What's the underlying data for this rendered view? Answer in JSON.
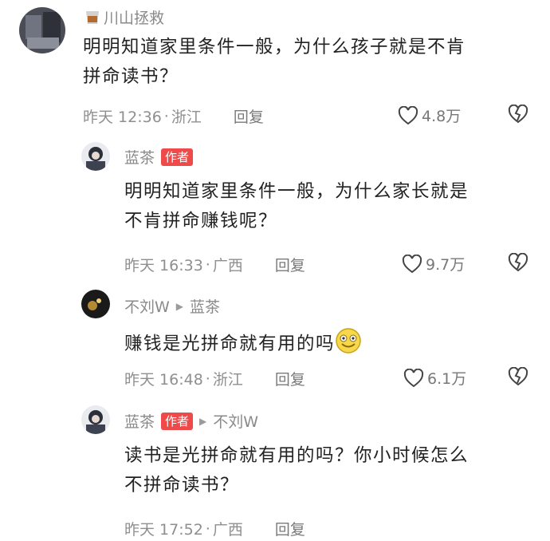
{
  "comments": [
    {
      "username": "川山拯救",
      "text_line1": "明明知道家里条件一般，为什么孩子就是不肯",
      "text_line2": "拼命读书？",
      "time": "昨天 12:36",
      "location": "浙江",
      "reply_label": "回复",
      "likes": "4.8万"
    },
    {
      "username": "蓝茶",
      "badge": "作者",
      "text_line1": "明明知道家里条件一般，为什么家长就是",
      "text_line2": "不肯拼命赚钱呢？",
      "time": "昨天 16:33",
      "location": "广西",
      "reply_label": "回复",
      "likes": "9.7万"
    },
    {
      "username": "不刘W",
      "reply_to": "蓝茶",
      "text_line1": "赚钱是光拼命就有用的吗",
      "time": "昨天 16:48",
      "location": "浙江",
      "reply_label": "回复",
      "likes": "6.1万"
    },
    {
      "username": "蓝茶",
      "badge": "作者",
      "reply_to": "不刘W",
      "text_line1": "读书是光拼命就有用的吗？你小时候怎么",
      "text_line2": "不拼命读书？",
      "time": "昨天 17:52",
      "location": "广西",
      "reply_label": "回复"
    }
  ],
  "separator": "·",
  "colors": {
    "author_badge": "#ef4a4a",
    "meta_text": "#8f8f8f",
    "body_text": "#222222"
  },
  "icons": {
    "like": "heart-outline-icon",
    "dislike": "broken-heart-icon",
    "reply_arrow": "triangle-right-icon"
  }
}
